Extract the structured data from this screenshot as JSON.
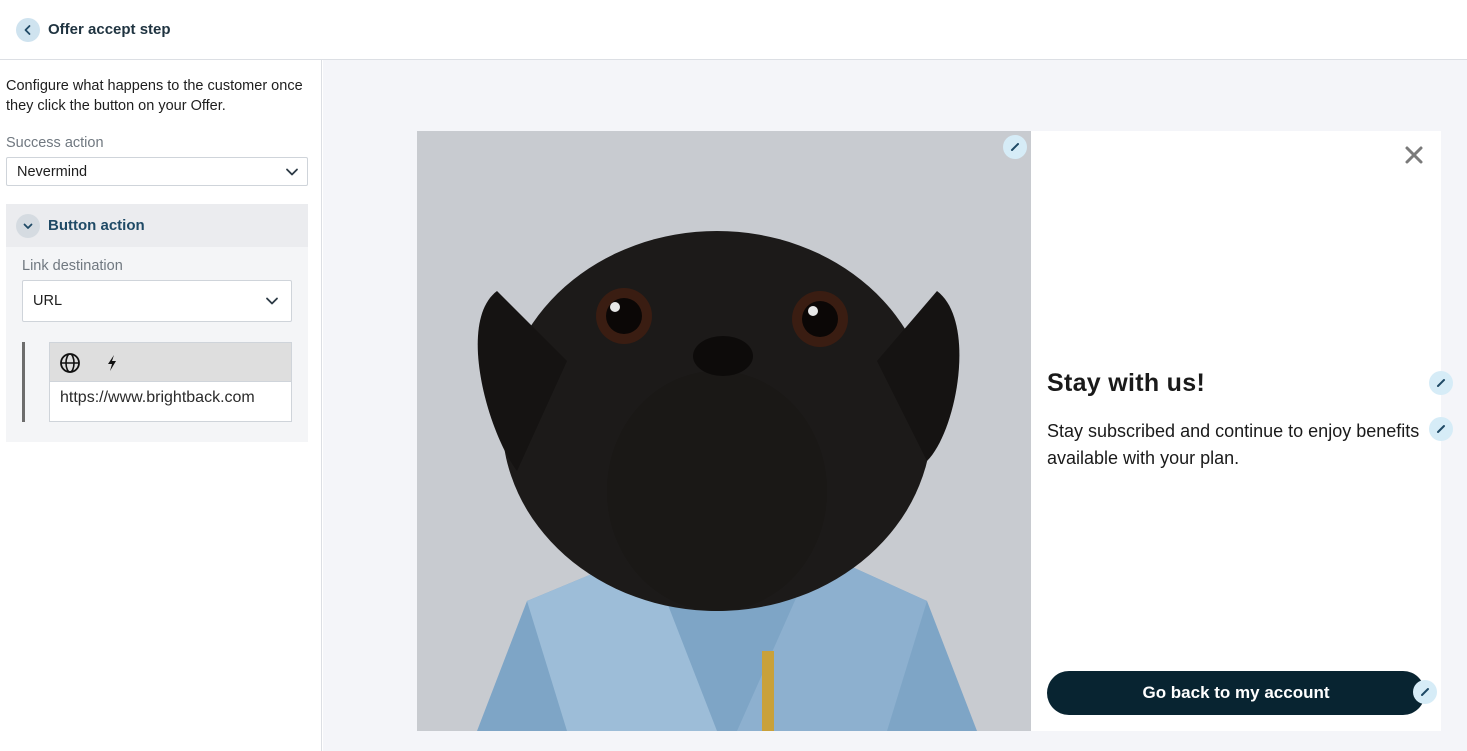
{
  "header": {
    "title": "Offer accept step",
    "back_icon": "chevron-left-icon"
  },
  "sidebar": {
    "description": "Configure what happens to the customer once they click the button on your Offer.",
    "success_action": {
      "label": "Success action",
      "value": "Nevermind"
    },
    "button_action": {
      "title": "Button action",
      "link_destination": {
        "label": "Link destination",
        "value": "URL"
      },
      "url_editor": {
        "tabs": [
          "globe-icon",
          "lightning-icon"
        ],
        "value": "https://www.brightback.com"
      }
    }
  },
  "offer": {
    "image_alt": "Black pug wearing a denim jacket",
    "title": "Stay with us!",
    "body": "Stay subscribed and continue to enjoy benefits available with your plan.",
    "cta_label": "Go back to my account"
  },
  "colors": {
    "cta_bg": "#082431",
    "accent": "#1f4a66",
    "edit_badge": "#d6ecf7"
  }
}
